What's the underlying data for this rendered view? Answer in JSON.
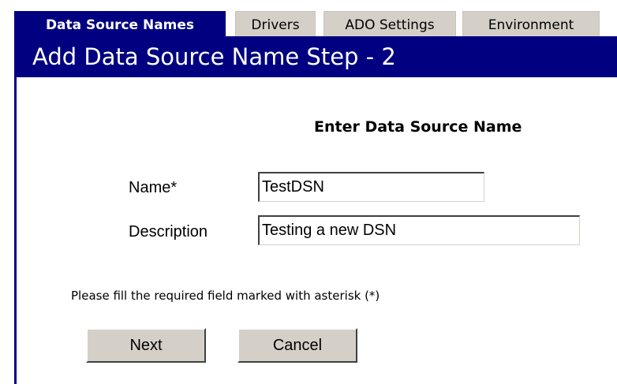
{
  "tabs": [
    {
      "label": "Data Source Names",
      "active": true
    },
    {
      "label": "Drivers",
      "active": false
    },
    {
      "label": "ADO Settings",
      "active": false
    },
    {
      "label": "Environment",
      "active": false
    }
  ],
  "header": {
    "title": "Add Data Source Name Step - 2"
  },
  "form": {
    "section_title": "Enter Data Source Name",
    "name_label": "Name*",
    "name_value": "TestDSN",
    "description_label": "Description",
    "description_value": "Testing a new DSN",
    "note": "Please fill the required field marked with asterisk (*)"
  },
  "buttons": {
    "next": "Next",
    "cancel": "Cancel"
  },
  "colors": {
    "accent": "#000080",
    "button_face": "#d4d0c8",
    "tab_inactive": "#d4d0c8"
  }
}
